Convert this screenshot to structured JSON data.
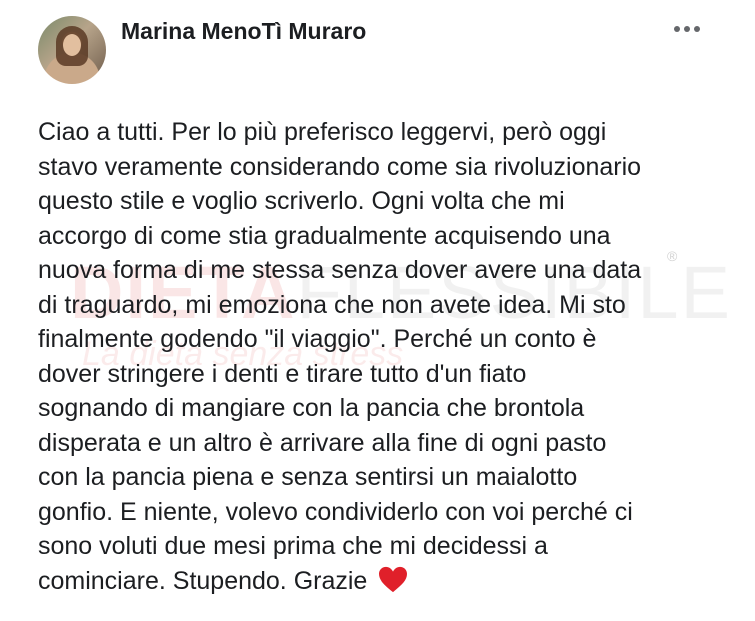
{
  "post": {
    "author": "Marina MenoTì Muraro",
    "more_icon": "more-horizontal-icon",
    "lines": [
      "Ciao a tutti. Per lo più preferisco leggervi, però oggi",
      "stavo veramente considerando come sia rivoluzionario",
      "questo stile e voglio scriverlo. Ogni volta che mi",
      "accorgo di come stia gradualmente acquisendo una",
      "nuova forma di me stessa senza dover avere una data",
      "di traguardo, mi emoziona che non avete idea. Mi sto",
      "finalmente godendo \"il viaggio\". Perché un conto è",
      "dover stringere i denti e tirare tutto d'un fiato",
      "sognando di mangiare con la pancia che brontola",
      "disperata e un altro è arrivare alla fine di ogni pasto",
      "con la pancia piena e senza sentirsi un maialotto",
      "gonfio. E niente, volevo condividerlo con voi perché ci",
      "sono voluti due mesi prima che mi decidessi a",
      "cominciare. Stupendo. Grazie"
    ],
    "heart_icon": "red-heart-icon",
    "heart_color": "#e0202a"
  },
  "watermark": {
    "main_bold": "DIETA",
    "main_light": "FLESSIBILE",
    "registered": "®",
    "tagline": "La dieta senza stress"
  }
}
